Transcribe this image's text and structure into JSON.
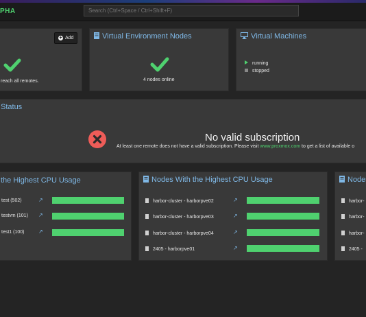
{
  "topbar": {
    "brand": "PHA",
    "search_placeholder": "Search (Ctrl+Space / Ctrl+Shift+F)"
  },
  "remotes_panel": {
    "add_label": "Add",
    "status_text": "reach all remotes."
  },
  "nodes_panel": {
    "title": "Virtual Environment Nodes",
    "status_text": "4 nodes online"
  },
  "vms_panel": {
    "title": "Virtual Machines",
    "legend": [
      "running",
      "stopped"
    ]
  },
  "subscription": {
    "section_title": "Status",
    "heading": "No valid subscription",
    "message_prefix": "At least one remote does not have a valid subscription. Please visit",
    "link": "www.proxmox.com",
    "message_suffix": "to get a list of available o"
  },
  "guests_cpu": {
    "title": "the Highest CPU Usage",
    "rows": [
      {
        "label": "test (502)",
        "usage": 1.0
      },
      {
        "label": "testvm (101)",
        "usage": 1.0
      },
      {
        "label": "test1 (100)",
        "usage": 1.0
      }
    ]
  },
  "nodes_cpu": {
    "title": "Nodes With the Highest CPU Usage",
    "rows": [
      {
        "label": "harbor-cluster  -  harborpve02",
        "usage": 1.0
      },
      {
        "label": "harbor-cluster  -  harborpve03",
        "usage": 1.0
      },
      {
        "label": "harbor-cluster  -  harborpve04",
        "usage": 1.0
      },
      {
        "label": "2405  -  harborpve01",
        "usage": 1.0
      }
    ]
  },
  "third_panel": {
    "title": "Nodes",
    "rows": [
      "harbor-",
      "harbor-",
      "harbor-",
      "2405  -"
    ]
  },
  "colors": {
    "accent_green": "#4fd16f",
    "title_blue": "#7fb8e6",
    "error_red": "#ee5c58"
  }
}
